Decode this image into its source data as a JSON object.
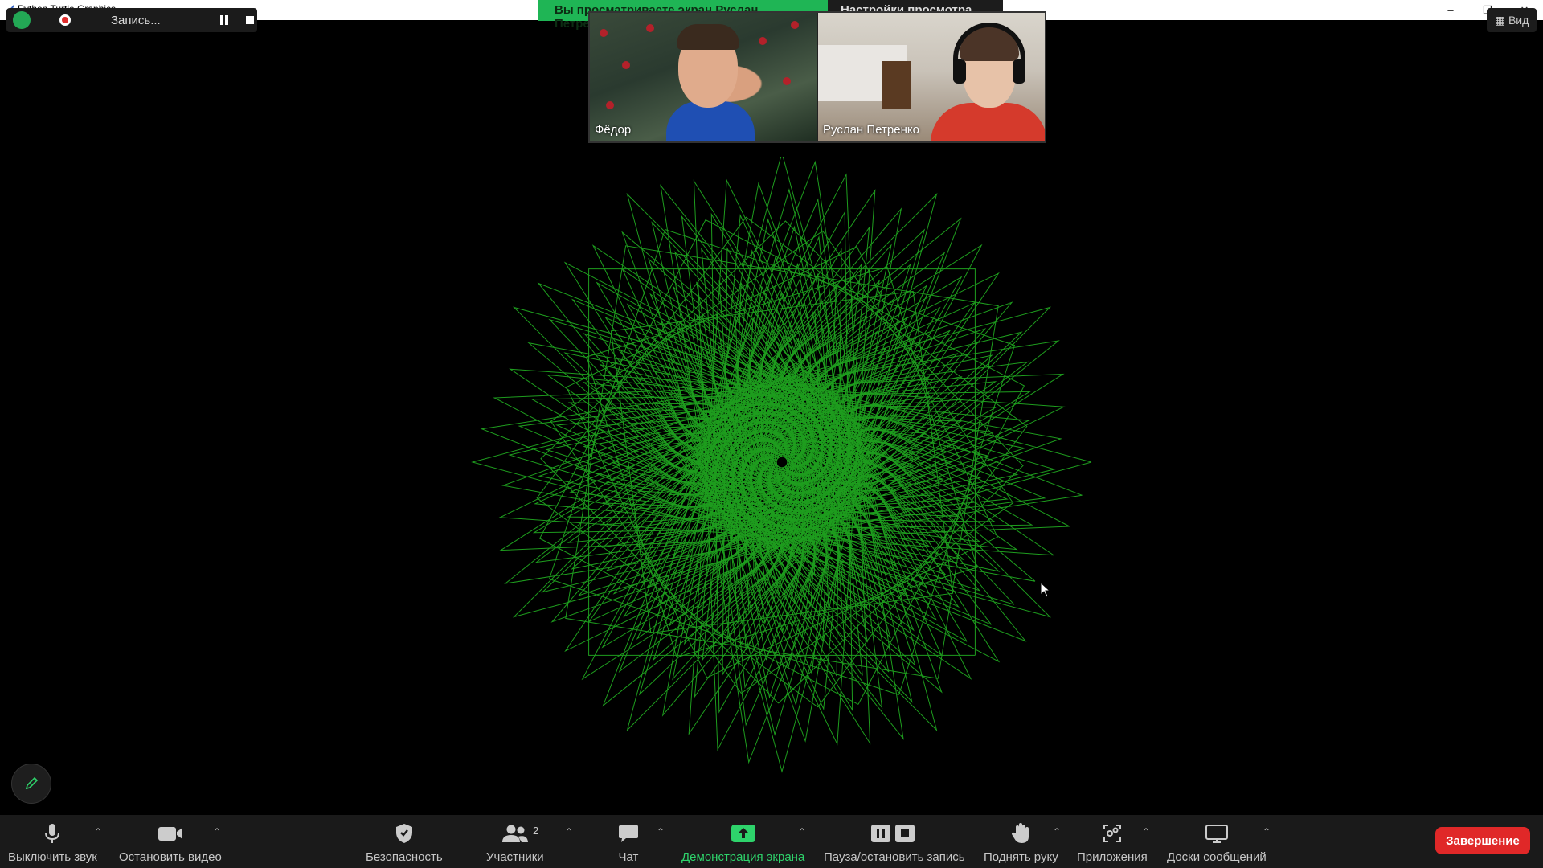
{
  "window": {
    "title": "Python Turtle Graphics"
  },
  "recording": {
    "label": "Запись..."
  },
  "share_banner": {
    "text": "Вы просматриваете экран Руслан Петренко",
    "view_settings": "Настройки просмотра",
    "view_button": "Вид"
  },
  "videos": [
    {
      "name": "Фёдор"
    },
    {
      "name": "Руслан Петренко"
    }
  ],
  "toolbar": {
    "mute": "Выключить звук",
    "video": "Остановить видео",
    "security": "Безопасность",
    "participants": "Участники",
    "participants_count": "2",
    "chat": "Чат",
    "share": "Демонстрация экрана",
    "record": "Пауза/остановить запись",
    "raise_hand": "Поднять руку",
    "apps": "Приложения",
    "whiteboards": "Доски сообщений",
    "end": "Завершение"
  },
  "colors": {
    "share_green": "#1fb555",
    "drawing_green": "#1e9d1e",
    "end_red": "#e02828",
    "toolbar_bg": "#1a1a1a"
  }
}
